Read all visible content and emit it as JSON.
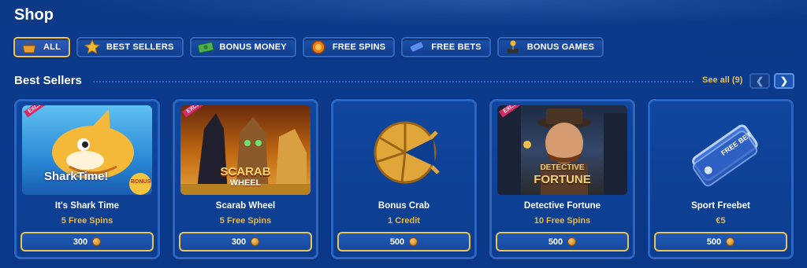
{
  "page": {
    "title": "Shop"
  },
  "filters": [
    {
      "label": "ALL",
      "icon": "basket-icon",
      "active": true
    },
    {
      "label": "BEST SELLERS",
      "icon": "star-icon"
    },
    {
      "label": "BONUS MONEY",
      "icon": "money-icon"
    },
    {
      "label": "FREE SPINS",
      "icon": "spin-icon"
    },
    {
      "label": "FREE BETS",
      "icon": "ticket-icon"
    },
    {
      "label": "BONUS GAMES",
      "icon": "joystick-icon"
    }
  ],
  "section": {
    "title": "Best Sellers",
    "see_all": "See all (9)",
    "prev_icon": "chevron-left-icon",
    "next_icon": "chevron-right-icon"
  },
  "cards": [
    {
      "name": "It's Shark Time",
      "reward": "5 Free Spins",
      "price": "300",
      "badge": "EXCLUSIVE",
      "art_text": "SharkTime!",
      "art_sub": "BONUS"
    },
    {
      "name": "Scarab Wheel",
      "reward": "5 Free Spins",
      "price": "300",
      "badge": "EXCLUSIVE",
      "art_text": "SCARAB",
      "art_sub": "WHEEL"
    },
    {
      "name": "Bonus Crab",
      "reward": "1 Credit",
      "price": "500"
    },
    {
      "name": "Detective Fortune",
      "reward": "10 Free Spins",
      "price": "500",
      "badge": "EXCLUSIVE",
      "art_text": "DETECTIVE",
      "art_sub": "FORTUNE"
    },
    {
      "name": "Sport Freebet",
      "reward": "€5",
      "price": "500",
      "art_text": "FREE BET"
    }
  ],
  "colors": {
    "accent": "#e8b948",
    "card_border": "#2a66c4",
    "badge": "#d42a6a"
  }
}
